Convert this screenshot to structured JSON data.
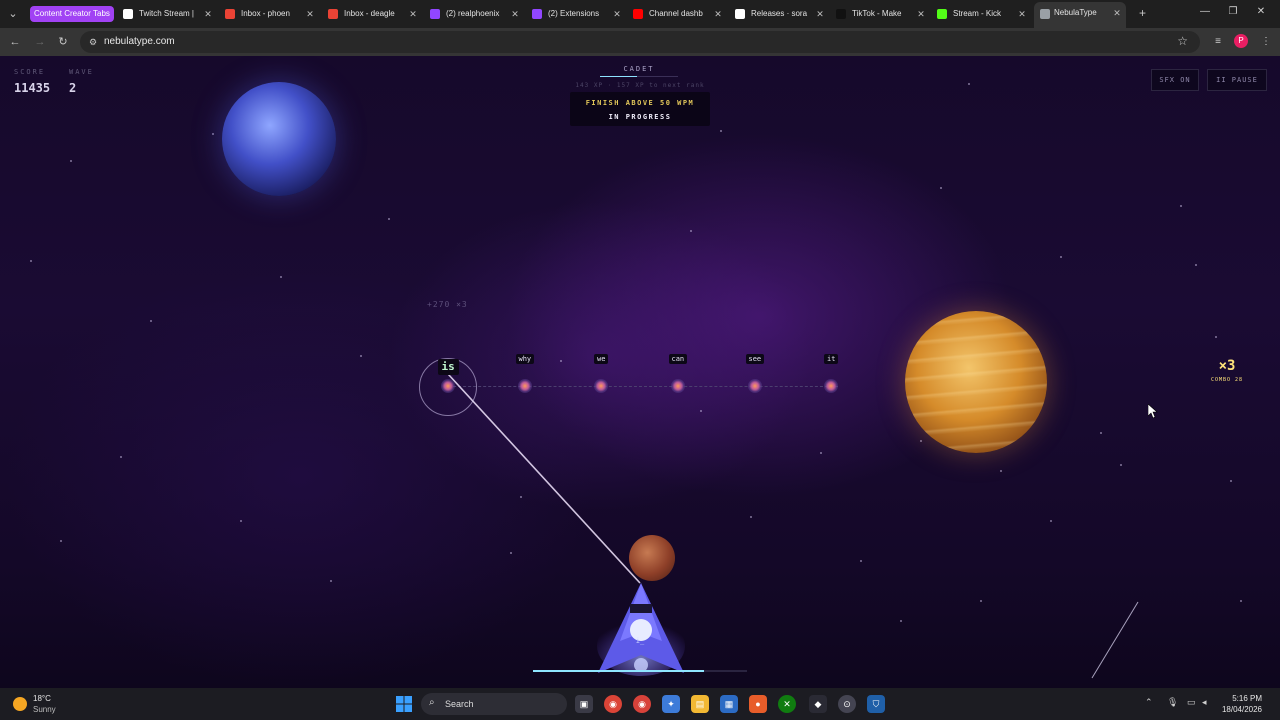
{
  "browser": {
    "tab_group_label": "Content Creator Tabs",
    "tabs": [
      {
        "label": "Twitch Stream |",
        "icon": "twitch-icon",
        "color": "#ffffff"
      },
      {
        "label": "Inbox - phoen",
        "icon": "gmail-icon",
        "color": "#ea4335"
      },
      {
        "label": "Inbox - deagle",
        "icon": "gmail-icon",
        "color": "#ea4335"
      },
      {
        "label": "(2) realphoenix",
        "icon": "twitch-icon",
        "color": "#9146ff"
      },
      {
        "label": "(2) Extensions",
        "icon": "twitch-icon",
        "color": "#9146ff"
      },
      {
        "label": "Channel dashb",
        "icon": "youtube-icon",
        "color": "#ff0000"
      },
      {
        "label": "Releases · sora",
        "icon": "github-icon",
        "color": "#ffffff"
      },
      {
        "label": "TikTok - Make",
        "icon": "tiktok-icon",
        "color": "#111111"
      },
      {
        "label": "Stream - Kick",
        "icon": "kick-icon",
        "color": "#53fc18"
      },
      {
        "label": "NebulaType",
        "icon": "globe-icon",
        "color": "#9aa0a6",
        "active": true
      }
    ],
    "url": "nebulatype.com",
    "profile_initial": "P"
  },
  "game": {
    "score_label": "SCORE",
    "score": "11435",
    "wave_label": "WAVE",
    "wave": "2",
    "rank": "CADET",
    "rank_progress": 0.48,
    "xp_text": "143 XP · 157 XP to next rank",
    "mission_title": "FINISH ABOVE 50 WPM",
    "mission_status": "IN PROGRESS",
    "sfx_label": "SFX ON",
    "pause_label": "II PAUSE",
    "floater": "+270 ×3",
    "words": [
      "is",
      "why",
      "we",
      "can",
      "see",
      "it"
    ],
    "active_word_index": 0,
    "combo_multiplier": "×3",
    "combo_label": "COMBO 28",
    "typed_text": "i_",
    "wave_progress": 0.8,
    "accent_color": "#8fe6ff"
  },
  "taskbar": {
    "weather_temp": "18°C",
    "weather_desc": "Sunny",
    "search_label": "Search",
    "time": "5:16 PM",
    "date": "18/04/2026"
  }
}
